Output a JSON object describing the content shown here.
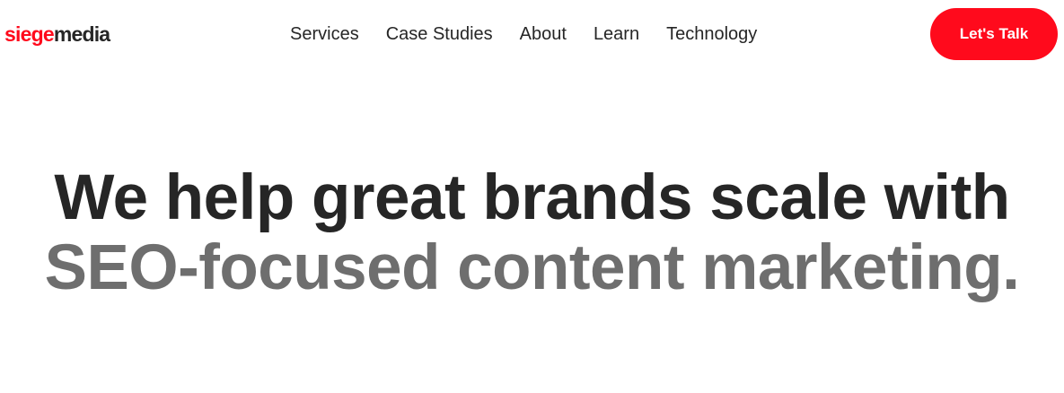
{
  "header": {
    "logo": {
      "part1": "siege",
      "part2": "media"
    },
    "nav": [
      {
        "label": "Services"
      },
      {
        "label": "Case Studies"
      },
      {
        "label": "About"
      },
      {
        "label": "Learn"
      },
      {
        "label": "Technology"
      }
    ],
    "cta_label": "Let's Talk"
  },
  "hero": {
    "headline_line1": "We help great brands scale with",
    "headline_line2": "SEO-focused content marketing."
  },
  "colors": {
    "brand_red": "#ff0a1c",
    "text_dark": "#262626",
    "text_gray": "#6e6e6e",
    "background": "#ffffff"
  }
}
